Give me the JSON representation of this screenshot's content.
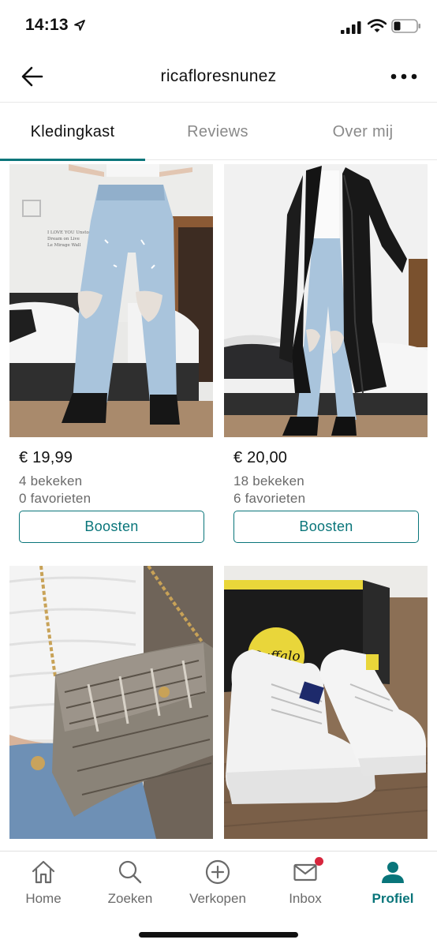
{
  "status_bar": {
    "time": "14:13",
    "icons": [
      "location-arrow-icon",
      "signal-icon",
      "wifi-icon",
      "battery-icon"
    ]
  },
  "header": {
    "title": "ricafloresnunez",
    "back_icon": "arrow-left-icon",
    "more_icon": "more-horizontal-icon"
  },
  "tabs": [
    {
      "label": "Kledingkast",
      "active": true
    },
    {
      "label": "Reviews",
      "active": false
    },
    {
      "label": "Over mij",
      "active": false
    }
  ],
  "items": [
    {
      "image": "ripped-jeans-photo",
      "price": "€ 19,99",
      "views": "4 bekeken",
      "favorites": "0 favorieten",
      "button": "Boosten"
    },
    {
      "image": "leather-coat-jeans-photo",
      "price": "€ 20,00",
      "views": "18 bekeken",
      "favorites": "6 favorieten",
      "button": "Boosten"
    },
    {
      "image": "snakeskin-bag-photo"
    },
    {
      "image": "white-boots-photo",
      "logo_text": "Buffalo"
    }
  ],
  "bottom_nav": [
    {
      "label": "Home",
      "icon": "home-icon",
      "active": false
    },
    {
      "label": "Zoeken",
      "icon": "search-icon",
      "active": false
    },
    {
      "label": "Verkopen",
      "icon": "plus-circle-icon",
      "active": false
    },
    {
      "label": "Inbox",
      "icon": "mail-icon",
      "active": false,
      "badge": true
    },
    {
      "label": "Profiel",
      "icon": "profile-icon",
      "active": true
    }
  ],
  "colors": {
    "accent": "#09757a",
    "badge": "#d7263d",
    "muted_text": "#6a6a6a"
  }
}
